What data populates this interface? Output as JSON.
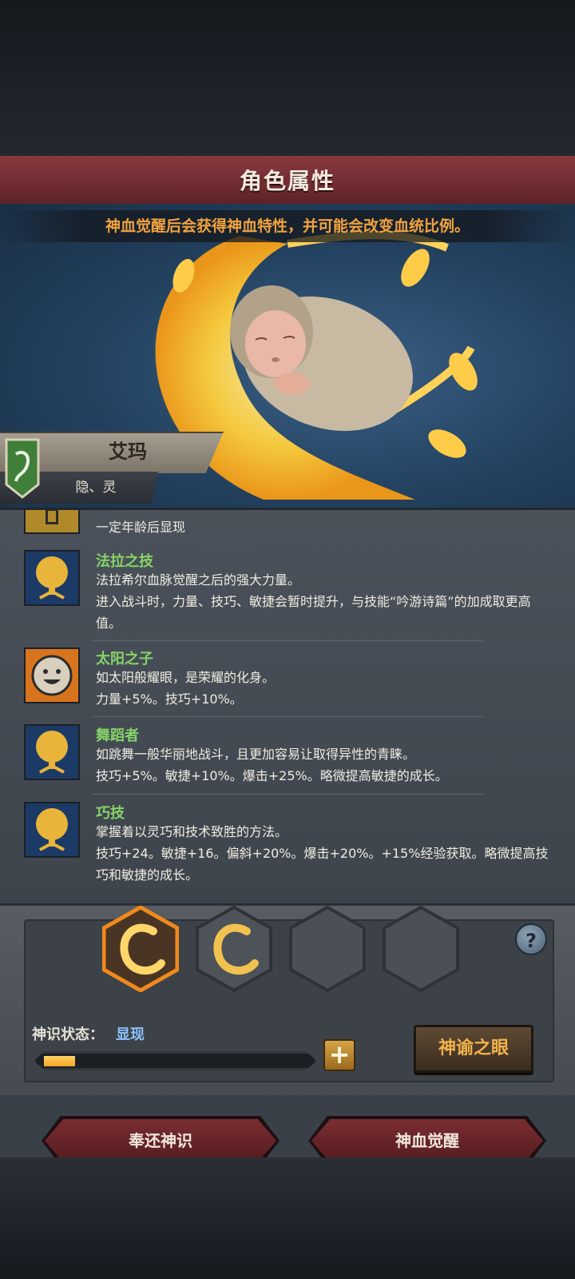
{
  "header": {
    "title": "角色属性"
  },
  "hero": {
    "hint": "神血觉醒后会获得神血特性，并可能会改变血统比例。"
  },
  "character": {
    "name": "艾玛",
    "traits_label": "隐、灵"
  },
  "traits": [
    {
      "name": "",
      "desc": "一定年龄后显现",
      "icon": "locked-trait-icon"
    },
    {
      "name": "法拉之技",
      "desc": "法拉希尔血脉觉醒之后的强大力量。\n进入战斗时，力量、技巧、敏捷会暂时提升，与技能“吟游诗篇”的加成取更高值。",
      "icon": "golden-tree-icon"
    },
    {
      "name": "太阳之子",
      "desc": "如太阳般耀眼，是荣耀的化身。\n力量+5%。技巧+10%。",
      "icon": "smiling-sun-icon"
    },
    {
      "name": "舞蹈者",
      "desc": "如跳舞一般华丽地战斗，且更加容易让取得异性的青睐。\n技巧+5%。敏捷+10%。爆击+25%。略微提高敏捷的成长。",
      "icon": "golden-tree-icon"
    },
    {
      "name": "巧技",
      "desc": "掌握着以灵巧和技术致胜的方法。\n技巧+24。敏捷+16。偏斜+20%。爆击+20%。+15%经验获取。略微提高技巧和敏捷的成长。",
      "icon": "golden-tree-icon"
    }
  ],
  "divine": {
    "status_label": "神识状态：",
    "status_value": "显现",
    "progress": 0.12,
    "oracle_button": "神谕之眼",
    "plus_label": "+",
    "help_label": "?",
    "slots": [
      "filled-selected",
      "filled",
      "empty",
      "empty"
    ]
  },
  "buttons": {
    "return": "奉还神识",
    "awaken": "神血觉醒"
  },
  "colors": {
    "accent_red": "#7a2d31",
    "trait_name": "#86d468",
    "hint": "#f1a23f"
  }
}
